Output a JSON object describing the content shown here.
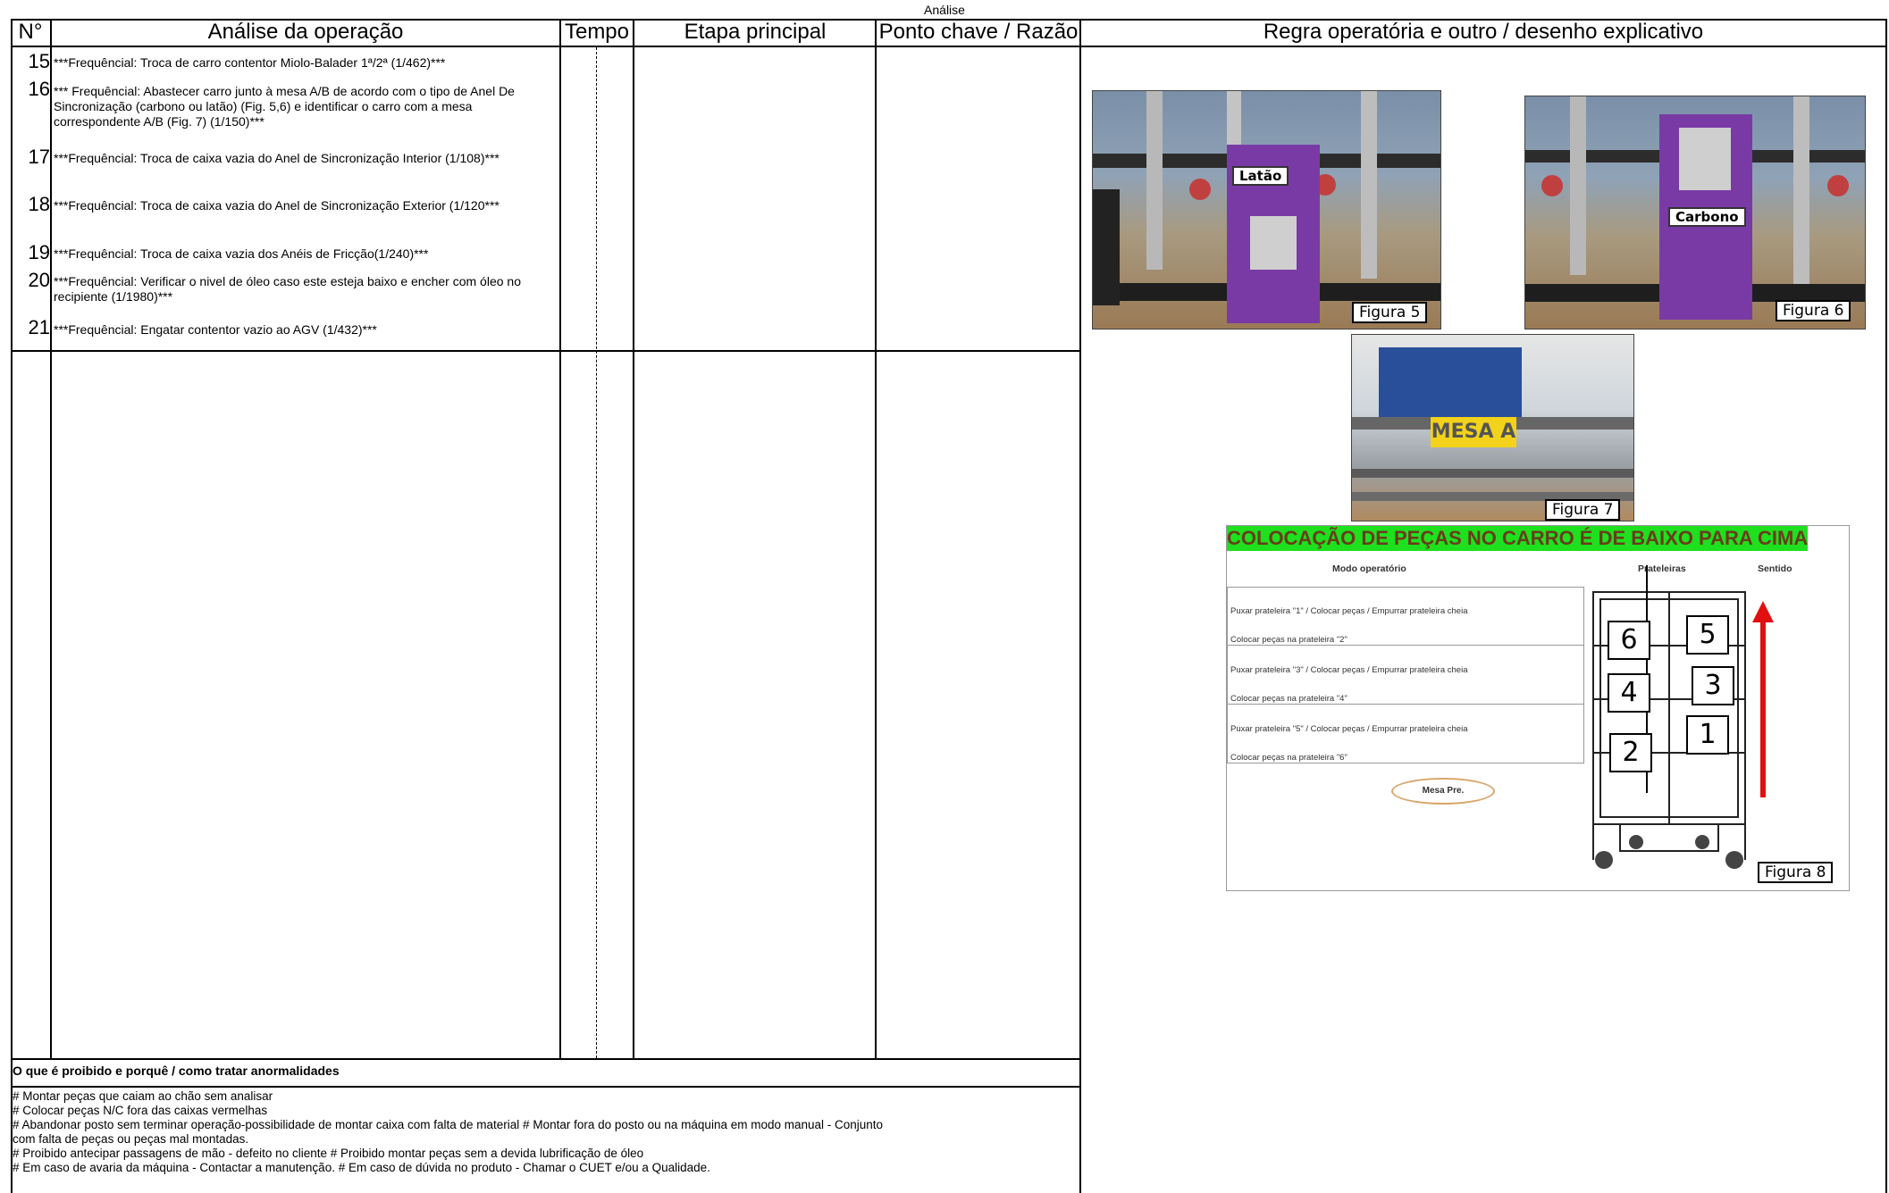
{
  "sheet_title": "Análise",
  "headers": {
    "num": "N°",
    "analysis": "Análise da operação",
    "time": "Tempo",
    "step": "Etapa principal",
    "key": "Ponto chave / Razão",
    "rule": "Regra operatória e outro / desenho explicativo"
  },
  "rows": [
    {
      "n": "15",
      "text": "***Frequêncial: Troca de carro contentor Miolo-Balader 1ª/2ª (1/462)***"
    },
    {
      "n": "16",
      "text": "*** Frequêncial: Abastecer carro junto à mesa A/B de acordo com o tipo de Anel De Sincronização (carbono ou latão) (Fig. 5,6) e  identificar o carro com a mesa correspondente A/B  (Fig. 7) (1/150)***"
    },
    {
      "n": "17",
      "text": "***Frequêncial: Troca de caixa vazia do Anel de Sincronização Interior (1/108)***"
    },
    {
      "n": "18",
      "text": "***Frequêncial: Troca de caixa vazia do Anel de Sincronização Exterior (1/120***"
    },
    {
      "n": "19",
      "text": "***Frequêncial: Troca de caixa vazia dos Anéis de Fricção(1/240)***"
    },
    {
      "n": "20",
      "text": "***Frequêncial: Verificar o nivel de óleo caso este esteja baixo e encher com óleo no recipiente (1/1980)***"
    },
    {
      "n": "21",
      "text": "***Frequêncial: Engatar contentor vazio ao AGV (1/432)***"
    }
  ],
  "forbidden": {
    "title": "O que é proibido e porquê / como tratar anormalidades",
    "lines": [
      "# Montar peças que caiam ao chão sem analisar",
      "# Colocar peças N/C fora das caixas vermelhas",
      "# Abandonar posto sem terminar operação-possibilidade de montar caixa com falta de material # Montar fora do posto ou na máquina em modo manual - Conjunto",
      "com falta de peças ou peças mal montadas.",
      "# Proibido antecipar passagens de mão - defeito no cliente # Proibido montar peças sem a devida lubrificação de óleo",
      "# Em caso de avaria da máquina - Contactar a manutenção.  # Em caso de dúvida no produto  - Chamar o CUET e/ou a Qualidade."
    ]
  },
  "figures": {
    "fig5": {
      "caption": "Figura 5",
      "tag": "Latão"
    },
    "fig6": {
      "caption": "Figura 6",
      "tag": "Carbono"
    },
    "fig7": {
      "caption": "Figura 7",
      "tag": "MESA A"
    },
    "fig8": {
      "caption": "Figura 8",
      "banner": "COLOCAÇÃO DE PEÇAS NO CARRO É DE BAIXO PARA CIMA",
      "col_mode": "Modo operatório",
      "col_shelves": "Prateleiras",
      "col_direction": "Sentido",
      "instructions": [
        "Puxar prateleira \"1\" / Colocar peças / Empurrar prateleira cheia",
        "Colocar peças na prateleira \"2\"",
        "Puxar prateleira \"3\" / Colocar peças / Empurrar prateleira cheia",
        "Colocar peças na prateleira \"4\"",
        "Puxar prateleira \"5\" / Colocar peças / Empurrar prateleira cheia",
        "Colocar peças na prateleira \"6\""
      ],
      "oval_label": "Mesa Pre.",
      "shelf_numbers": [
        "6",
        "5",
        "4",
        "3",
        "2",
        "1"
      ]
    }
  },
  "colors": {
    "banner": "#1ee01e",
    "banner_text": "#6a3c1c",
    "arrow": "#e01010",
    "purple": "#7a3aa6"
  }
}
